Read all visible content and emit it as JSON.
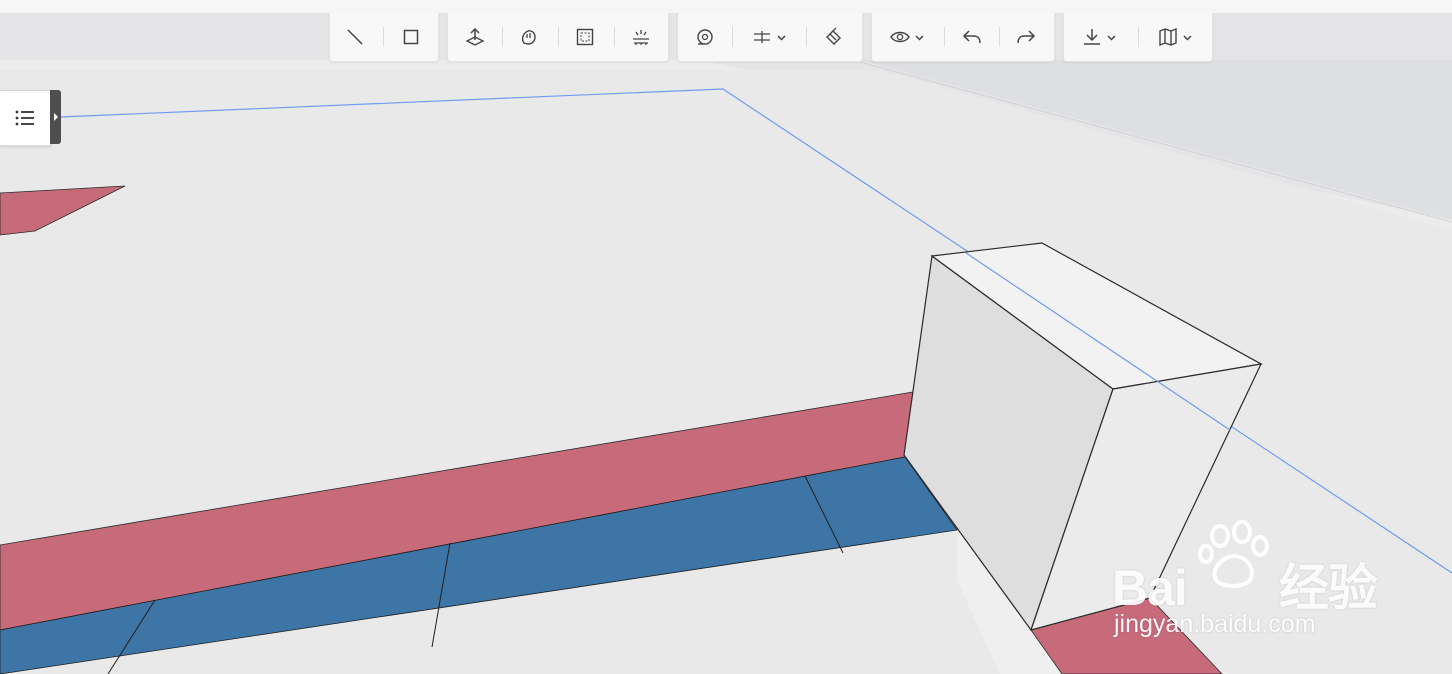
{
  "watermark": {
    "brand_prefix": "Bai",
    "brand_suffix": "经验",
    "url": "jingyan.baidu.com"
  },
  "colors": {
    "background": "#ececed",
    "ground": "#e9e9ea",
    "wall_far": "#dfdfe1",
    "red_band": "#c76b7b",
    "blue_band": "#3d75a7",
    "selection_line": "#6f9cf0",
    "box_front": "#dedede",
    "box_top": "#f2f2f2",
    "box_side": "#ebebeb"
  },
  "toolbar": {
    "groups": [
      {
        "name": "draw-tools",
        "tools": [
          "line-icon",
          "rectangle-icon"
        ]
      },
      {
        "name": "modify-tools",
        "tools": [
          "push-pull-icon",
          "orbit-hand-icon",
          "select-area-icon",
          "light-icon"
        ]
      },
      {
        "name": "measure-tools",
        "tools": [
          "tape-measure-icon",
          "section-plane-icon",
          "paint-bucket-icon"
        ]
      },
      {
        "name": "view-tools",
        "tools": [
          "eye-icon",
          "undo-icon",
          "redo-icon"
        ]
      },
      {
        "name": "export-tools",
        "tools": [
          "download-icon",
          "map-icon"
        ]
      }
    ]
  },
  "outline_panel": {
    "icon": "list-icon",
    "toggle_icon": "caret-right-icon"
  }
}
